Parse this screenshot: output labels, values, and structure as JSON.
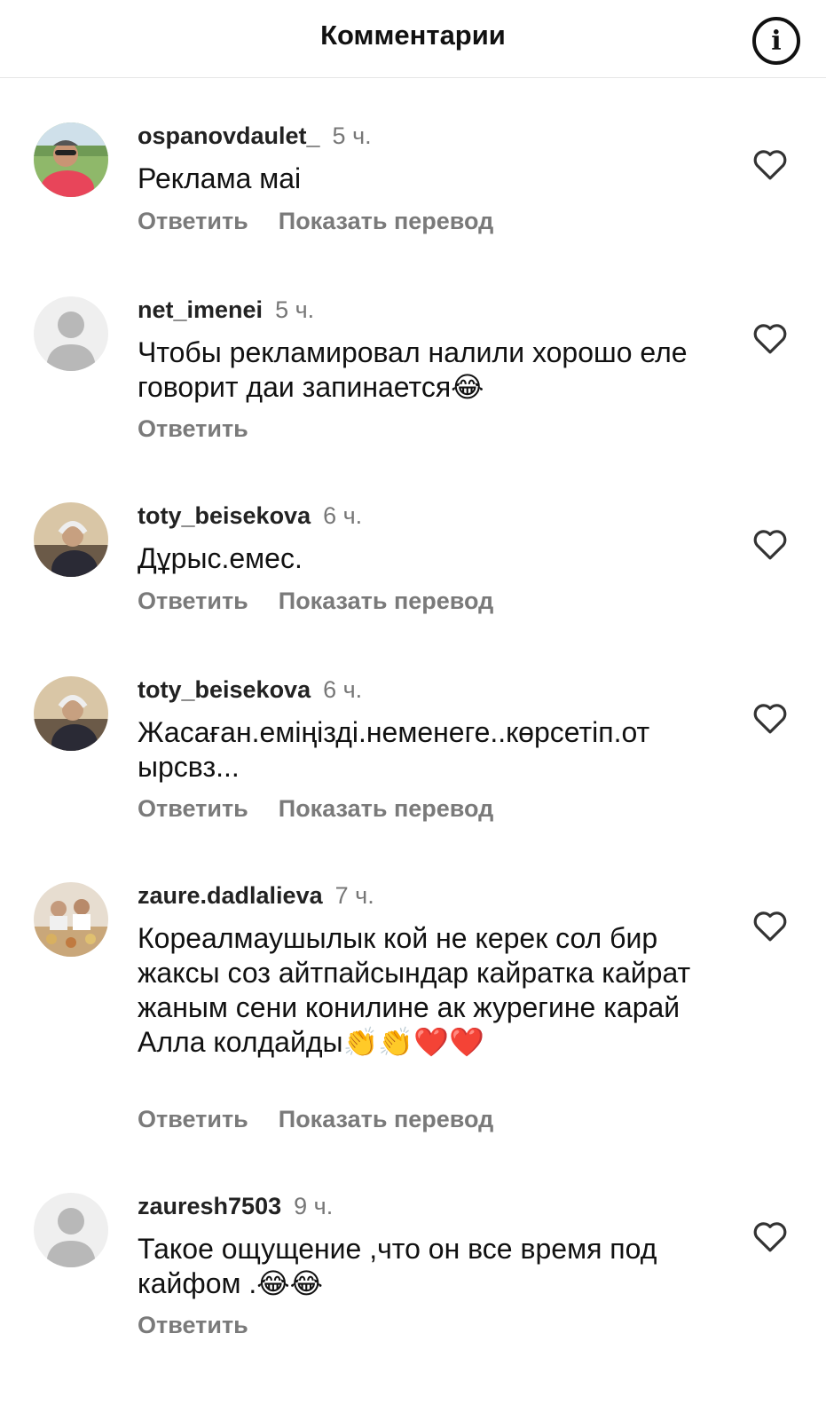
{
  "header": {
    "title": "Комментарии",
    "info_icon": "info-icon"
  },
  "labels": {
    "reply": "Ответить",
    "translate": "Показать перевод"
  },
  "comments": [
    {
      "username": "ospanovdaulet_",
      "time": "5 ч.",
      "text": "Реклама маі",
      "translate": true,
      "avatar": "photo-man"
    },
    {
      "username": "net_imenei",
      "time": "5 ч.",
      "text": "Чтобы рекламировал налили хорошо еле говорит даи запинается😂",
      "translate": false,
      "avatar": "default-avatar"
    },
    {
      "username": "toty_beisekova",
      "time": "6 ч.",
      "text": "Дұрыс.емес.",
      "translate": true,
      "avatar": "photo-woman"
    },
    {
      "username": "toty_beisekova",
      "time": "6 ч.",
      "text": "Жасаған.еміңізді.неменеге..көрсетіп.от ырсвз...",
      "translate": true,
      "avatar": "photo-woman"
    },
    {
      "username": "zaure.dadlalieva",
      "time": "7 ч.",
      "text": "Кореалмаушылык кой не керек сол бир жаксы соз айтпайсындар кайратка кайрат жаным сени конилине ак журегине карай Алла колдайды👏👏❤️❤️",
      "translate": true,
      "avatar": "photo-group"
    },
    {
      "username": "zauresh7503",
      "time": "9 ч.",
      "text": "Такое ощущение ,что он все время под кайфом .😂😂",
      "translate": false,
      "avatar": "default-avatar"
    }
  ]
}
